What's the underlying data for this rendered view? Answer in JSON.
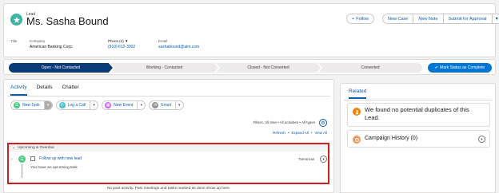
{
  "header": {
    "object_label": "Lead",
    "record_name": "Ms. Sasha Bound",
    "icon": "lead-star-icon",
    "buttons": {
      "follow": "Follow",
      "new_case": "New Case",
      "new_note": "New Note",
      "submit_for_approval": "Submit for Approval"
    },
    "fields": {
      "title_label": "Title",
      "title_value": "",
      "company_label": "Company",
      "company_value": "American Banking Corp.",
      "phone_label": "Phone (2)",
      "phone_value": "(910) 612-3302",
      "email_label": "Email",
      "email_value": "sashabound@aim.com"
    }
  },
  "path": {
    "stages": [
      "Open - Not Contacted",
      "Working - Contacted",
      "Closed - Not Converted",
      "Converted"
    ],
    "current_stage": "Open - Not Contacted",
    "mark_button": "Mark Status as Complete"
  },
  "activity": {
    "tabs": [
      "Activity",
      "Details",
      "Chatter"
    ],
    "active_tab": "Activity",
    "actions": {
      "new_task": "New Task",
      "log_a_call": "Log a Call",
      "new_event": "New Event",
      "email": "Email"
    },
    "filters_text": "Filters: All time • All activities • All types",
    "links": {
      "refresh": "Refresh",
      "expand_all": "Expand All",
      "view_all": "View All"
    },
    "upcoming": {
      "heading": "Upcoming & Overdue",
      "task_title": "Follow up with new lead",
      "task_description": "You have an upcoming task",
      "task_date": "Tomorrow"
    },
    "no_past": "No past activity. Past meetings and tasks marked as done show up here."
  },
  "related": {
    "tab": "Related",
    "duplicates_text": "We found no potential duplicates of this Lead.",
    "campaign_history": "Campaign History (0)"
  },
  "colors": {
    "brand_blue": "#0176d3",
    "path_current": "#0b3a78",
    "link_blue": "#0b5cab",
    "highlight_border": "#d01e1e",
    "task_green": "#4bca81",
    "lead_teal": "#3cb4a4"
  }
}
